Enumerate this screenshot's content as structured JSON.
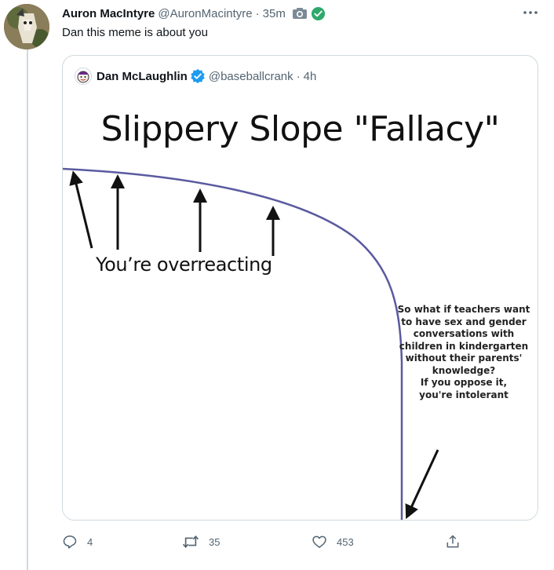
{
  "author": {
    "name": "Auron MacIntyre",
    "handle": "@AuronMacintyre",
    "separator": "·",
    "time": "35m",
    "text": "Dan this meme is about you",
    "icons": [
      "camera-icon",
      "verified-check-icon",
      "more-icon"
    ]
  },
  "quote": {
    "name": "Dan McLaughlin",
    "handle": "@baseballcrank",
    "separator": "·",
    "time": "4h",
    "meme": {
      "title": "Slippery Slope \"Fallacy\"",
      "caption": "You’re overreacting",
      "side_lines": [
        "So what if teachers want",
        "to have sex and gender",
        "conversations with",
        "children in kindergarten",
        "without their parents'",
        "knowledge?",
        "If you oppose it,",
        "you're intolerant"
      ]
    }
  },
  "actions": {
    "replies": "4",
    "retweets": "35",
    "likes": "453"
  },
  "colors": {
    "text": "#0f1419",
    "muted": "#536471",
    "border": "#cfd9de",
    "verified": "#1d9bf0",
    "curve": "#5a5aa0"
  }
}
